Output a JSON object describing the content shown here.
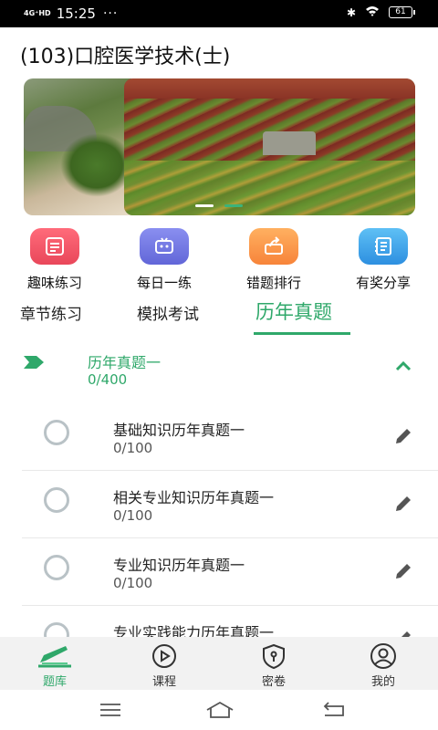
{
  "status_bar": {
    "network": "4G⁺HD",
    "time": "15:25",
    "dots": "···",
    "battery": "61"
  },
  "page": {
    "title": "(103)口腔医学技术(士)"
  },
  "quick_actions": [
    {
      "label": "趣味练习",
      "icon": "quiz-icon"
    },
    {
      "label": "每日一练",
      "icon": "daily-robot-icon"
    },
    {
      "label": "错题排行",
      "icon": "wrong-rank-icon"
    },
    {
      "label": "有奖分享",
      "icon": "share-icon"
    }
  ],
  "tabs": {
    "items": [
      "章节练习",
      "模拟考试",
      "历年真题"
    ],
    "active": "历年真题"
  },
  "section": {
    "title": "历年真题一",
    "count": "0/400"
  },
  "list": [
    {
      "title": "基础知识历年真题一",
      "count": "0/100"
    },
    {
      "title": "相关专业知识历年真题一",
      "count": "0/100"
    },
    {
      "title": "专业知识历年真题一",
      "count": "0/100"
    },
    {
      "title": "专业实践能力历年真题一",
      "count": ""
    }
  ],
  "bottom_nav": [
    {
      "label": "题库",
      "icon": "question-bank-icon",
      "active": true
    },
    {
      "label": "课程",
      "icon": "play-icon",
      "active": false
    },
    {
      "label": "密卷",
      "icon": "lock-shield-icon",
      "active": false
    },
    {
      "label": "我的",
      "icon": "profile-icon",
      "active": false
    }
  ],
  "colors": {
    "accent": "#2fa86a",
    "muted": "#b9c2c6"
  }
}
